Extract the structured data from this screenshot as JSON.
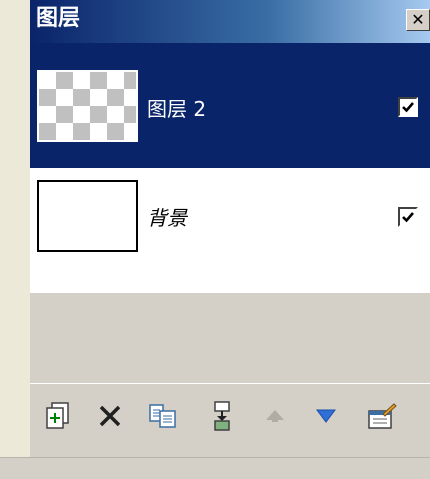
{
  "panel": {
    "title": "图层",
    "close_glyph": "✕"
  },
  "layers": [
    {
      "name": "图层 2",
      "visible": true,
      "selected": true,
      "thumbnail": "transparent-checkerboard"
    },
    {
      "name": "背景",
      "visible": true,
      "selected": false,
      "thumbnail": "white"
    }
  ],
  "toolbar": {
    "buttons": [
      {
        "id": "new-layer",
        "icon": "new-layer-icon"
      },
      {
        "id": "delete-layer",
        "icon": "delete-icon"
      },
      {
        "id": "duplicate-layer",
        "icon": "duplicate-icon"
      },
      {
        "id": "merge-down",
        "icon": "merge-down-icon"
      },
      {
        "id": "move-up",
        "icon": "arrow-up-icon",
        "disabled": true
      },
      {
        "id": "move-down",
        "icon": "arrow-down-icon"
      },
      {
        "id": "layer-properties",
        "icon": "properties-icon"
      }
    ]
  },
  "colors": {
    "selection": "#0a246a",
    "panel_bg": "#d4d0c8",
    "accent_blue": "#3a6ea5"
  }
}
